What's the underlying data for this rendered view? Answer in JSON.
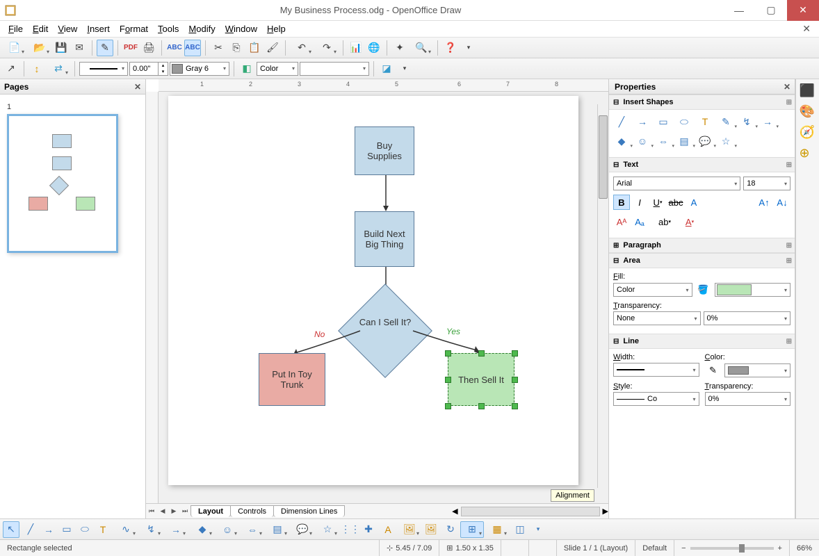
{
  "titlebar": {
    "title": "My Business Process.odg - OpenOffice Draw"
  },
  "menu": [
    "File",
    "Edit",
    "View",
    "Insert",
    "Format",
    "Tools",
    "Modify",
    "Window",
    "Help"
  ],
  "toolbar2": {
    "line_width_value": "0.00\"",
    "color_name": "Gray 6",
    "fill_type": "Color"
  },
  "pages_panel": {
    "title": "Pages",
    "page_number": "1"
  },
  "canvas": {
    "ruler_ticks": [
      "1",
      "2",
      "3",
      "4",
      "5",
      "6",
      "7",
      "8"
    ],
    "shapes": {
      "buy": "Buy Supplies",
      "build": "Build Next Big Thing",
      "decision": "Can I Sell It?",
      "no": "No",
      "yes": "Yes",
      "put": "Put In Toy Trunk",
      "sell": "Then Sell It"
    },
    "tabs": [
      "Layout",
      "Controls",
      "Dimension Lines"
    ],
    "tooltip": "Alignment"
  },
  "properties": {
    "title": "Properties",
    "sections": {
      "insert_shapes": "Insert Shapes",
      "text": "Text",
      "paragraph": "Paragraph",
      "area": "Area",
      "line": "Line"
    },
    "text": {
      "font": "Arial",
      "size": "18"
    },
    "area": {
      "fill_label": "Fill:",
      "fill_type": "Color",
      "transparency_label": "Transparency:",
      "transparency_type": "None",
      "transparency_value": "0%"
    },
    "line": {
      "width_label": "Width:",
      "color_label": "Color:",
      "style_label": "Style:",
      "style_value": "Co",
      "transparency_label": "Transparency:",
      "transparency_value": "0%"
    }
  },
  "statusbar": {
    "selection": "Rectangle selected",
    "pos": "5.45 / 7.09",
    "size": "1.50 x 1.35",
    "slide": "Slide 1 / 1 (Layout)",
    "style": "Default",
    "zoom": "66%"
  }
}
